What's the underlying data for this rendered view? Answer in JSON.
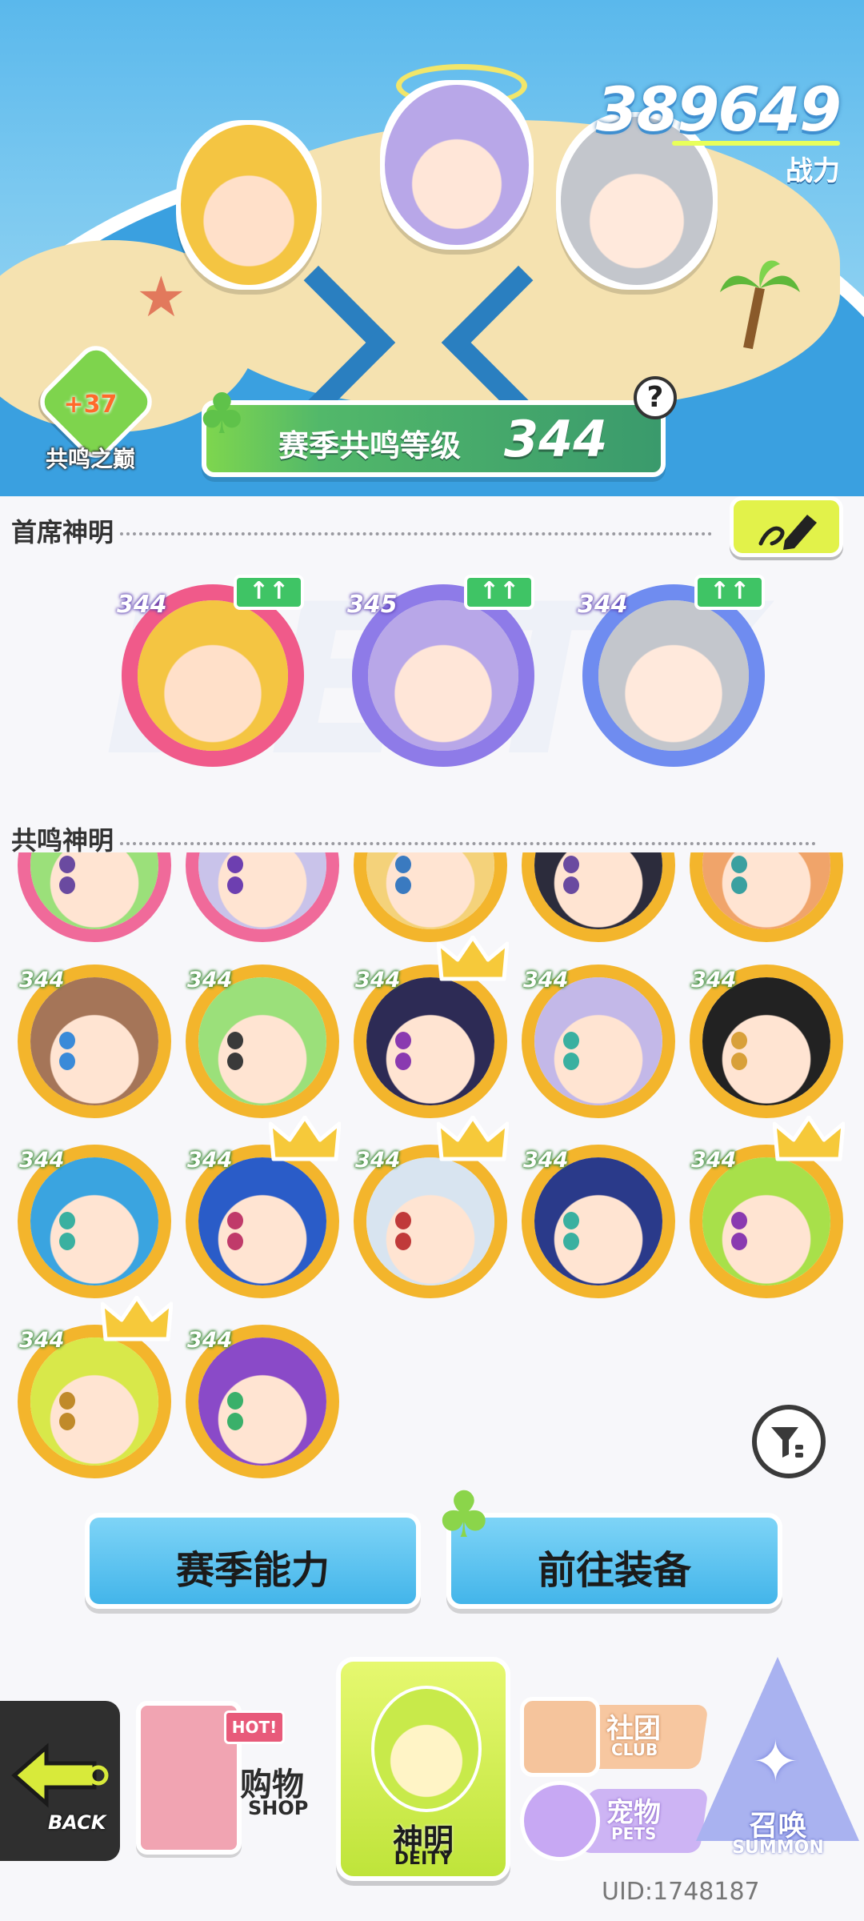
{
  "header": {
    "power_value": "389649",
    "power_label": "战力"
  },
  "peak": {
    "bonus": "+37",
    "name": "共鸣之巅"
  },
  "resonance": {
    "label": "赛季共鸣等级",
    "level": "344",
    "help": "?"
  },
  "chief_section": {
    "title": "首席神明",
    "bg_text": "DEITY",
    "deities": [
      {
        "level": "344",
        "up": "↑↑",
        "ring": "#f05a8a",
        "hair": "#f4c542",
        "skin": "#ffe0c9"
      },
      {
        "level": "345",
        "up": "↑↑",
        "ring": "#8e7be8",
        "hair": "#b8a7e8",
        "skin": "#ffe6d8"
      },
      {
        "level": "344",
        "up": "↑↑",
        "ring": "#6f8cf0",
        "hair": "#c3c6cc",
        "skin": "#ffe9dc"
      }
    ]
  },
  "resonance_section": {
    "title": "共鸣神明",
    "deities": [
      {
        "level": "",
        "ring": "#f06a9a",
        "hair": "#9be07a",
        "eye": "#6a4aa0",
        "crown": false
      },
      {
        "level": "",
        "ring": "#f06a9a",
        "hair": "#c9c3ea",
        "eye": "#6d3fb0",
        "crown": false
      },
      {
        "level": "",
        "ring": "#f3b52c",
        "hair": "#f4d27a",
        "eye": "#3a7ac0",
        "crown": false
      },
      {
        "level": "",
        "ring": "#f3b52c",
        "hair": "#2c2c3c",
        "eye": "#6a4aa0",
        "crown": false
      },
      {
        "level": "",
        "ring": "#f3b52c",
        "hair": "#f0a46a",
        "eye": "#3aa0a0",
        "crown": false
      },
      {
        "level": "344",
        "ring": "#f3b52c",
        "hair": "#a57558",
        "eye": "#3a8ad8",
        "crown": false
      },
      {
        "level": "344",
        "ring": "#f3b52c",
        "hair": "#9be07a",
        "eye": "#3a3a3a",
        "crown": false
      },
      {
        "level": "344",
        "ring": "#f3b52c",
        "hair": "#2d2b55",
        "eye": "#8a3ab0",
        "crown": true
      },
      {
        "level": "344",
        "ring": "#f3b52c",
        "hair": "#c3b8e8",
        "eye": "#3ab0a0",
        "crown": false
      },
      {
        "level": "344",
        "ring": "#f3b52c",
        "hair": "#222222",
        "eye": "#d8a03a",
        "crown": false
      },
      {
        "level": "344",
        "ring": "#f3b52c",
        "hair": "#3aa4e0",
        "eye": "#3ab0a0",
        "crown": false
      },
      {
        "level": "344",
        "ring": "#f3b52c",
        "hair": "#2a5cc8",
        "eye": "#c03a6a",
        "crown": true
      },
      {
        "level": "344",
        "ring": "#f3b52c",
        "hair": "#d8e4f0",
        "eye": "#c03a3a",
        "crown": true
      },
      {
        "level": "344",
        "ring": "#f3b52c",
        "hair": "#2a3a8a",
        "eye": "#3ab0a0",
        "crown": false
      },
      {
        "level": "344",
        "ring": "#f3b52c",
        "hair": "#a8e04a",
        "eye": "#8a3ab0",
        "crown": true
      },
      {
        "level": "344",
        "ring": "#f3b52c",
        "hair": "#d8e84a",
        "eye": "#c08a2a",
        "crown": true
      },
      {
        "level": "344",
        "ring": "#f3b52c",
        "hair": "#8a4ac8",
        "eye": "#3ab06a",
        "crown": false
      }
    ]
  },
  "actions": {
    "season_ability": "赛季能力",
    "go_equip": "前往装备"
  },
  "nav": {
    "back": "BACK",
    "shop_hot": "HOT!",
    "shop": "购物",
    "shop_sub": "SHOP",
    "deity": "神明",
    "deity_sub": "DEITY",
    "club": "社团",
    "club_sub": "CLUB",
    "pets": "宠物",
    "pets_sub": "PETS",
    "summon": "召唤",
    "summon_sub": "SUMMON"
  },
  "uid": "UID:1748187",
  "colors": {
    "sky": "#5ab8ec",
    "accent_green": "#52b86a",
    "edit_yellow": "#e2f24a",
    "gold_ring": "#f3b52c",
    "action_blue": "#43b5ea"
  }
}
